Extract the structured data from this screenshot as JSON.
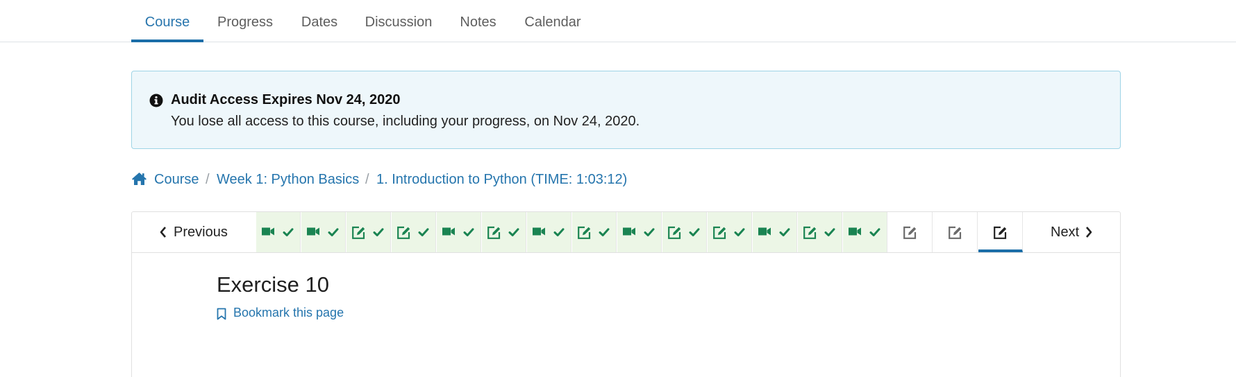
{
  "tabs": [
    {
      "label": "Course",
      "active": true
    },
    {
      "label": "Progress",
      "active": false
    },
    {
      "label": "Dates",
      "active": false
    },
    {
      "label": "Discussion",
      "active": false
    },
    {
      "label": "Notes",
      "active": false
    },
    {
      "label": "Calendar",
      "active": false
    }
  ],
  "alert": {
    "icon": "info-circle-icon",
    "title": "Audit Access Expires Nov 24, 2020",
    "body": "You lose all access to this course, including your progress, on Nov 24, 2020."
  },
  "breadcrumb": {
    "icon": "home-icon",
    "items": [
      "Course",
      "Week 1: Python Basics",
      "1. Introduction to Python (TIME: 1:03:12)"
    ],
    "separator": "/"
  },
  "sequence": {
    "previous_label": "Previous",
    "next_label": "Next",
    "units": [
      {
        "type": "video",
        "complete": true
      },
      {
        "type": "video",
        "complete": true
      },
      {
        "type": "problem",
        "complete": true
      },
      {
        "type": "problem",
        "complete": true
      },
      {
        "type": "video",
        "complete": true
      },
      {
        "type": "problem",
        "complete": true
      },
      {
        "type": "video",
        "complete": true
      },
      {
        "type": "problem",
        "complete": true
      },
      {
        "type": "video",
        "complete": true
      },
      {
        "type": "problem",
        "complete": true
      },
      {
        "type": "problem",
        "complete": true
      },
      {
        "type": "video",
        "complete": true
      },
      {
        "type": "problem",
        "complete": true
      },
      {
        "type": "video",
        "complete": true
      },
      {
        "type": "problem",
        "complete": false
      },
      {
        "type": "problem",
        "complete": false
      },
      {
        "type": "problem",
        "complete": false,
        "current": true
      }
    ]
  },
  "unit": {
    "title": "Exercise 10",
    "bookmark_label": "Bookmark this page",
    "bookmark_icon": "bookmark-icon"
  },
  "colors": {
    "accent": "#1b6ea8",
    "link": "#2575ad",
    "complete_green": "#1a8452",
    "complete_bg": "#ecf6e6",
    "alert_bg": "#eef7fb",
    "alert_border": "#9ed4e6"
  }
}
